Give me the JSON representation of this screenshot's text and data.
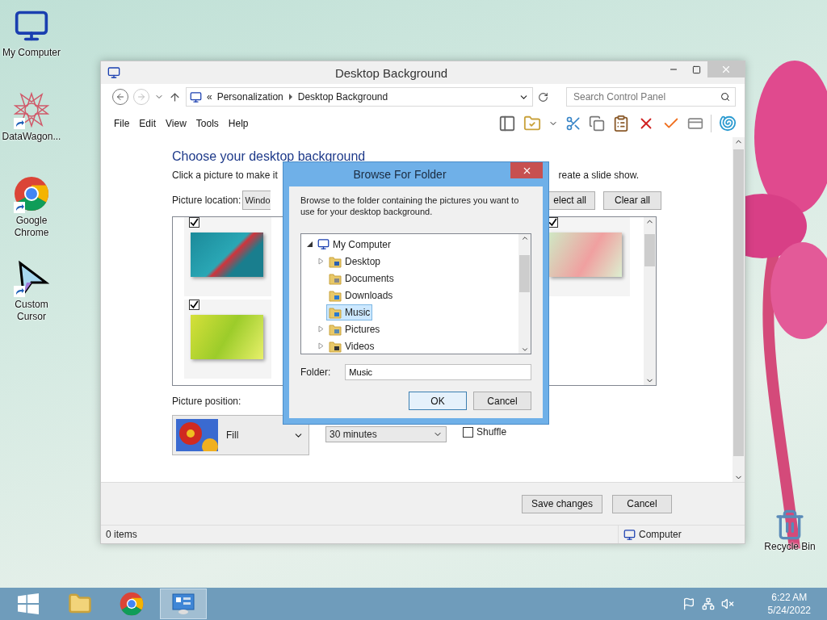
{
  "desktop_icons": [
    {
      "label": "My Computer",
      "kind": "computer",
      "shortcut": false
    },
    {
      "label": "DataWagon...",
      "kind": "star",
      "shortcut": true
    },
    {
      "label": "Google Chrome",
      "kind": "chrome",
      "shortcut": true
    },
    {
      "label": "Custom Cursor",
      "kind": "cursor",
      "shortcut": true
    }
  ],
  "recycle_bin": {
    "label": "Recycle Bin"
  },
  "window": {
    "title": "Desktop Background",
    "address": {
      "overflow": "«",
      "items": [
        "Personalization",
        "Desktop Background"
      ]
    },
    "search": {
      "placeholder": "Search Control Panel"
    },
    "menu": [
      "File",
      "Edit",
      "View",
      "Tools",
      "Help"
    ],
    "heading": "Choose your desktop background",
    "instruction_parts": [
      "Click a picture to make it",
      "reate a slide show."
    ],
    "picture_location": {
      "label": "Picture location:",
      "value": "Windo"
    },
    "selection_buttons": [
      "elect all",
      "Clear all"
    ],
    "pictures": [
      {
        "kind": "teal",
        "checked": true
      },
      {
        "kind": "leaf",
        "checked": true
      },
      {
        "kind": "blossom",
        "checked": true
      }
    ],
    "picture_position": {
      "label": "Picture position:",
      "value": "Fill"
    },
    "interval": {
      "value": "30 minutes"
    },
    "shuffle": {
      "label": "Shuffle",
      "checked": false
    },
    "buttons": [
      "Save changes",
      "Cancel"
    ],
    "status_bar": {
      "items": "0 items",
      "location": "Computer"
    }
  },
  "dialog": {
    "title": "Browse For Folder",
    "description": "Browse to the folder containing the pictures you want to use for your desktop background.",
    "tree": [
      {
        "label": "My Computer",
        "kind": "computer",
        "expanded": true,
        "selected": false,
        "children": [
          {
            "label": "Desktop",
            "kind": "desktop",
            "expanded": false,
            "selected": false
          },
          {
            "label": "Documents",
            "kind": "documents",
            "selected": false
          },
          {
            "label": "Downloads",
            "kind": "downloads",
            "selected": false
          },
          {
            "label": "Music",
            "kind": "music",
            "selected": true
          },
          {
            "label": "Pictures",
            "kind": "pictures",
            "expanded": false,
            "selected": false
          },
          {
            "label": "Videos",
            "kind": "videos",
            "expanded": false,
            "selected": false
          }
        ]
      }
    ],
    "folder": {
      "label": "Folder:",
      "value": "Music"
    },
    "buttons": [
      "OK",
      "Cancel"
    ]
  },
  "taskbar": {
    "apps": [
      {
        "kind": "explorer",
        "active": false
      },
      {
        "kind": "chrome",
        "active": false
      },
      {
        "kind": "control-panel",
        "active": true
      }
    ],
    "clock": {
      "time": "6:22 AM",
      "date": "5/24/2022"
    }
  }
}
